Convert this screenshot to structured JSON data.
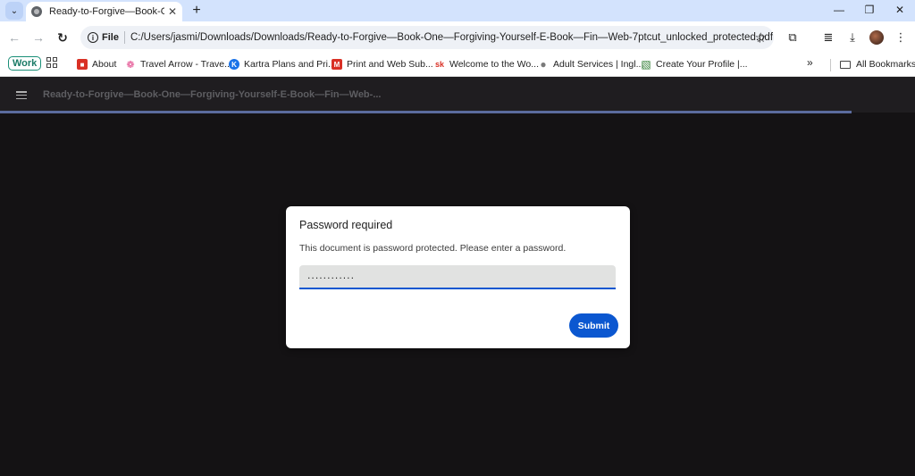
{
  "browser": {
    "tab_title": "Ready-to-Forgive—Book-One—Forgiving-Yourself",
    "scheme_label": "File",
    "url": "C:/Users/jasmi/Downloads/Downloads/Ready-to-Forgive—Book-One—Forgiving-Yourself-E-Book—Fin—Web-7ptcut_unlocked_protected.pdf",
    "icons": {
      "back": "←",
      "forward": "→",
      "reload": "↻",
      "star": "☆",
      "extensions": "⧉",
      "media": "≣",
      "download": "⤓",
      "more": "⋮",
      "minimize": "—",
      "restore": "❐",
      "close": "✕",
      "new_tab": "+",
      "tab_close": "✕",
      "tab_search": "⌄"
    }
  },
  "bookmarks": {
    "group_chip": "Work",
    "items": [
      {
        "label": "About",
        "fav": "■",
        "color": "#d93025"
      },
      {
        "label": "Travel Arrow - Trave...",
        "fav": "❁",
        "color": "#e24a8c"
      },
      {
        "label": "Kartra Plans and Pri...",
        "fav": "K",
        "color": "#1a73e8"
      },
      {
        "label": "Print and Web Sub...",
        "fav": "M",
        "color": "#d93025"
      },
      {
        "label": "Welcome to the Wo...",
        "fav": "sk",
        "color": "#ffffff"
      },
      {
        "label": "Adult Services | Ingl...",
        "fav": "●",
        "color": "#7a7a7a"
      },
      {
        "label": "Create Your Profile |...",
        "fav": "▧",
        "color": "#2e7d32"
      }
    ],
    "more": "»",
    "all_bookmarks": "All Bookmarks"
  },
  "pdf": {
    "title": "Ready-to-Forgive—Book-One—Forgiving-Yourself-E-Book—Fin—Web-..."
  },
  "dialog": {
    "title": "Password required",
    "message": "This document is password protected. Please enter a password.",
    "password_value": "............",
    "submit_label": "Submit"
  }
}
